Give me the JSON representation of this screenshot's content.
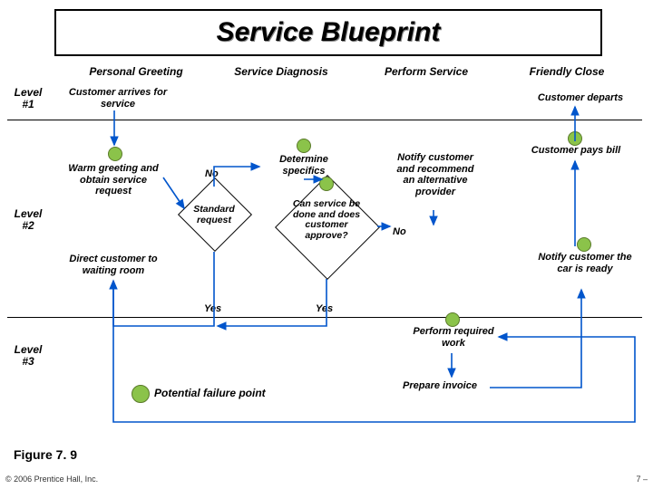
{
  "title": "Service Blueprint",
  "columns": {
    "c1": "Personal Greeting",
    "c2": "Service Diagnosis",
    "c3": "Perform Service",
    "c4": "Friendly Close"
  },
  "levels": {
    "l1a": "Level",
    "l1b": "#1",
    "l2a": "Level",
    "l2b": "#2",
    "l3a": "Level",
    "l3b": "#3"
  },
  "nodes": {
    "arrives": "Customer arrives\nfor service",
    "departs": "Customer departs",
    "greeting": "Warm greeting\nand obtain\nservice request",
    "pays": "Customer pays bill",
    "waiting": "Direct customer\nto waiting room",
    "ready": "Notify\ncustomer the\ncar is ready",
    "determine": "Determine\nspecifics",
    "notifyalt": "Notify\ncustomer\nand recommend\nan alternative\nprovider",
    "standard": "Standard\nrequest",
    "approve": "Can\nservice be\ndone and does\ncustomer\napprove?",
    "perform": "Perform\nrequired work",
    "invoice": "Prepare invoice"
  },
  "labels": {
    "no1": "No",
    "no2": "No",
    "yes1": "Yes",
    "yes2": "Yes",
    "pfp": "Potential failure point"
  },
  "figure": "Figure 7. 9",
  "copyright": "© 2006 Prentice Hall, Inc.",
  "pagenum": "7 –",
  "chart_data": {
    "type": "table",
    "description": "Service blueprint flowchart with levels (rows) and process phases (columns)",
    "columns": [
      "Personal Greeting",
      "Service Diagnosis",
      "Perform Service",
      "Friendly Close"
    ],
    "rows": [
      "Level #1",
      "Level #2",
      "Level #3"
    ],
    "nodes": [
      {
        "id": "arrives",
        "level": 1,
        "column": "Personal Greeting",
        "text": "Customer arrives for service",
        "failure_point": false
      },
      {
        "id": "departs",
        "level": 1,
        "column": "Friendly Close",
        "text": "Customer departs",
        "failure_point": false
      },
      {
        "id": "greeting",
        "level": 2,
        "column": "Personal Greeting",
        "text": "Warm greeting and obtain service request",
        "failure_point": true
      },
      {
        "id": "waiting",
        "level": 2,
        "column": "Personal Greeting",
        "text": "Direct customer to waiting room",
        "failure_point": false
      },
      {
        "id": "standard",
        "level": 2,
        "column": "Service Diagnosis",
        "text": "Standard request",
        "failure_point": false,
        "shape": "diamond"
      },
      {
        "id": "determine",
        "level": 2,
        "column": "Service Diagnosis",
        "text": "Determine specifics",
        "failure_point": true
      },
      {
        "id": "approve",
        "level": 2,
        "column": "Service Diagnosis",
        "text": "Can service be done and does customer approve?",
        "failure_point": true,
        "shape": "diamond"
      },
      {
        "id": "notifyalt",
        "level": 2,
        "column": "Perform Service",
        "text": "Notify customer and recommend an alternative provider",
        "failure_point": false
      },
      {
        "id": "ready",
        "level": 2,
        "column": "Friendly Close",
        "text": "Notify customer the car is ready",
        "failure_point": true
      },
      {
        "id": "pays",
        "level": 2,
        "column": "Friendly Close",
        "text": "Customer pays bill",
        "failure_point": true
      },
      {
        "id": "perform",
        "level": 3,
        "column": "Perform Service",
        "text": "Perform required work",
        "failure_point": true
      },
      {
        "id": "invoice",
        "level": 3,
        "column": "Perform Service",
        "text": "Prepare invoice",
        "failure_point": false
      }
    ],
    "edges": [
      {
        "from": "arrives",
        "to": "greeting"
      },
      {
        "from": "greeting",
        "to": "standard"
      },
      {
        "from": "standard",
        "to": "determine",
        "label": "No"
      },
      {
        "from": "determine",
        "to": "approve"
      },
      {
        "from": "approve",
        "to": "notifyalt",
        "label": "No"
      },
      {
        "from": "standard",
        "to": "waiting",
        "label": "Yes"
      },
      {
        "from": "approve",
        "to": "waiting",
        "label": "Yes"
      },
      {
        "from": "waiting",
        "to": "perform"
      },
      {
        "from": "perform",
        "to": "invoice"
      },
      {
        "from": "invoice",
        "to": "ready"
      },
      {
        "from": "ready",
        "to": "pays"
      },
      {
        "from": "pays",
        "to": "departs"
      }
    ]
  }
}
